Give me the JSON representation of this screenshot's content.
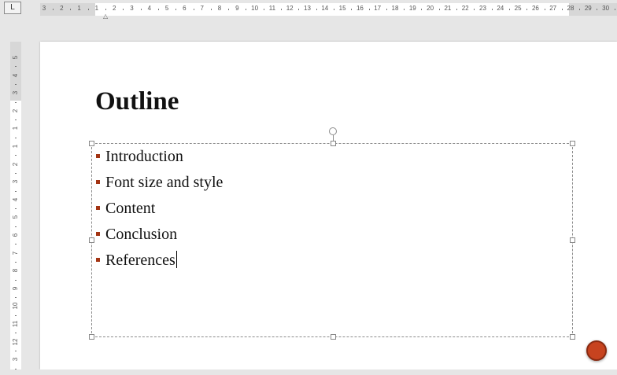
{
  "ruler": {
    "tab_selector_label": "L",
    "horizontal_labels": [
      "3",
      "2",
      "1",
      "1",
      "2",
      "3",
      "4",
      "5",
      "6",
      "7",
      "8",
      "9",
      "10",
      "11",
      "12",
      "13",
      "14",
      "15",
      "16",
      "17",
      "18",
      "19",
      "20",
      "21",
      "22",
      "23",
      "24",
      "25",
      "26",
      "27",
      "28",
      "29",
      "30"
    ],
    "vertical_labels": [
      "5",
      "4",
      "3",
      "2",
      "1",
      "1",
      "2",
      "3",
      "4",
      "5",
      "6",
      "7",
      "8",
      "9",
      "10",
      "11",
      "12",
      "3"
    ]
  },
  "slide": {
    "title": "Outline",
    "bullets": [
      "Introduction",
      "Font size and style",
      "Content",
      "Conclusion",
      "References"
    ]
  },
  "colors": {
    "bullet": "#a33413",
    "accent_button": "#c7431f"
  },
  "icons": {
    "tab_selector": "tab-stop-icon",
    "rotate_handle": "rotate-icon",
    "floating_button": "circle-button-icon"
  }
}
